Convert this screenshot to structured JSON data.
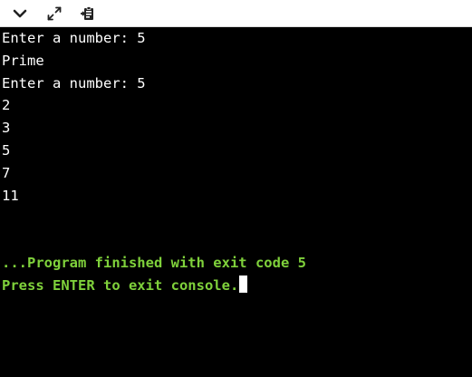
{
  "toolbar": {
    "buttons": [
      {
        "icon": "chevron-down-icon"
      },
      {
        "icon": "expand-icon"
      },
      {
        "icon": "clipboard-export-icon"
      }
    ]
  },
  "console": {
    "output_lines": [
      "Enter a number: 5",
      "Prime",
      "Enter a number: 5",
      "2",
      "3",
      "5",
      "7",
      "11"
    ],
    "exit_message": "...Program finished with exit code 5",
    "prompt_message": "Press ENTER to exit console."
  },
  "colors": {
    "background": "#000000",
    "text": "#ffffff",
    "status": "#7fd13b",
    "toolbar": "#ffffff"
  }
}
